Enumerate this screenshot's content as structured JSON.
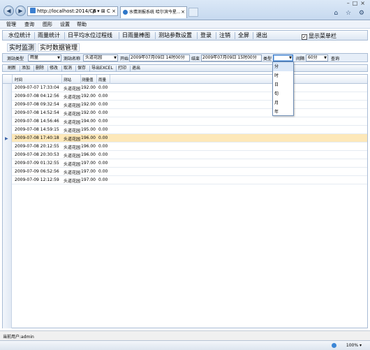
{
  "browser": {
    "address": "http://localhost:2014/CB",
    "address_icons": "ρ ▾ ⊠ C ×",
    "tab_title": "水情测报系统 哈尔滨今星...",
    "right_icons": "⌂ ☆ ⚙"
  },
  "menubar": [
    "管理",
    "查询",
    "图形",
    "设置",
    "帮助"
  ],
  "function_toolbar": {
    "buttons": [
      "水位统计",
      "雨量统计",
      "日平均水位过程线",
      "日雨量棒图",
      "测站参数设置",
      "登录",
      "注销",
      "全屏",
      "退出"
    ],
    "show_menu_label": "显示菜单栏",
    "show_menu_checked": true
  },
  "sub_tabs": [
    "实时监测",
    "实时数据管理"
  ],
  "filter": {
    "station_type_label": "测站类型",
    "station_type_value": "雨量",
    "station_name_label": "测站名称",
    "station_name_value": "头道花园",
    "start_label": "开始",
    "start_value": "2009年07月09日 14时00分",
    "end_label": "结束",
    "end_value": "2009年07月09日 15时00分",
    "type_label": "类型",
    "type_value": "",
    "interval_label": "间隔",
    "interval_value": "60分",
    "query_label": "查询"
  },
  "type_options": [
    "分",
    "时",
    "日",
    "旬",
    "月",
    "年"
  ],
  "actions": [
    "刷新",
    "添加",
    "删除",
    "修改",
    "取消",
    "保存",
    "导出EXCEL",
    "打印",
    "退出"
  ],
  "grid": {
    "columns": [
      "时间",
      "测站",
      "测量值",
      "雨量"
    ],
    "selected_index": 6,
    "rows": [
      [
        "2009-07-07 17:33:04",
        "头道花园",
        "192.00",
        "0.00"
      ],
      [
        "2009-07-08 04:12:56",
        "头道花园",
        "192.00",
        "0.00"
      ],
      [
        "2009-07-08 09:32:54",
        "头道花园",
        "192.00",
        "0.00"
      ],
      [
        "2009-07-08 14:52:54",
        "头道花园",
        "192.00",
        "0.00"
      ],
      [
        "2009-07-08 14:56:46",
        "头道花园",
        "194.00",
        "0.00"
      ],
      [
        "2009-07-08 14:59:15",
        "头道花园",
        "195.00",
        "0.00"
      ],
      [
        "2009-07-08 17:40:18",
        "头道花园",
        "196.00",
        "0.00"
      ],
      [
        "2009-07-08 20:12:55",
        "头道花园",
        "196.00",
        "0.00"
      ],
      [
        "2009-07-08 20:30:53",
        "头道花园",
        "196.00",
        "0.00"
      ],
      [
        "2009-07-09 01:32:55",
        "头道花园",
        "197.00",
        "0.00"
      ],
      [
        "2009-07-09 06:52:56",
        "头道花园",
        "197.00",
        "0.00"
      ],
      [
        "2009-07-09 12:12:59",
        "头道花园",
        "197.00",
        "0.00"
      ]
    ]
  },
  "status": {
    "user": "当前用户:admin",
    "zoom": "100%"
  }
}
